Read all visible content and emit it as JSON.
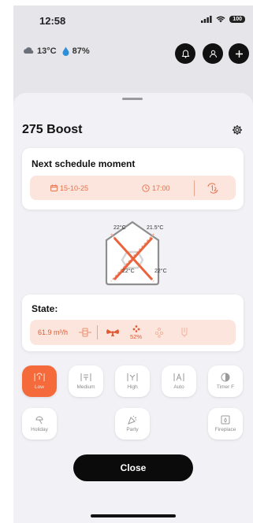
{
  "status_bar": {
    "time": "12:58",
    "battery": "100"
  },
  "weather": {
    "temperature": "13°C",
    "humidity": "87%"
  },
  "sheet": {
    "title": "275 Boost"
  },
  "schedule": {
    "title": "Next schedule moment",
    "date": "15-10-25",
    "time": "17:00"
  },
  "diagram": {
    "top_left": "22°C",
    "top_right": "21.5°C",
    "bottom_left": "22°C",
    "bottom_right": "22°C"
  },
  "state": {
    "title": "State:",
    "airflow": "61.9 m³/h",
    "humidity": "52%"
  },
  "modes": [
    {
      "label": "Low",
      "icon": "fan-low-icon",
      "active": true
    },
    {
      "label": "Medium",
      "icon": "fan-medium-icon",
      "active": false
    },
    {
      "label": "High",
      "icon": "fan-high-icon",
      "active": false
    },
    {
      "label": "Auto",
      "icon": "fan-auto-icon",
      "active": false
    },
    {
      "label": "Timer F",
      "icon": "timer-icon",
      "active": false
    },
    {
      "label": "Holiday",
      "icon": "holiday-icon",
      "active": false
    },
    {
      "label": "Party",
      "icon": "party-icon",
      "active": false
    },
    {
      "label": "Fireplace",
      "icon": "fireplace-icon",
      "active": false
    }
  ],
  "close_label": "Close",
  "colors": {
    "accent": "#f56a3a",
    "accent_light": "#fbe5dc",
    "sheet_bg": "#f2f1f5"
  }
}
